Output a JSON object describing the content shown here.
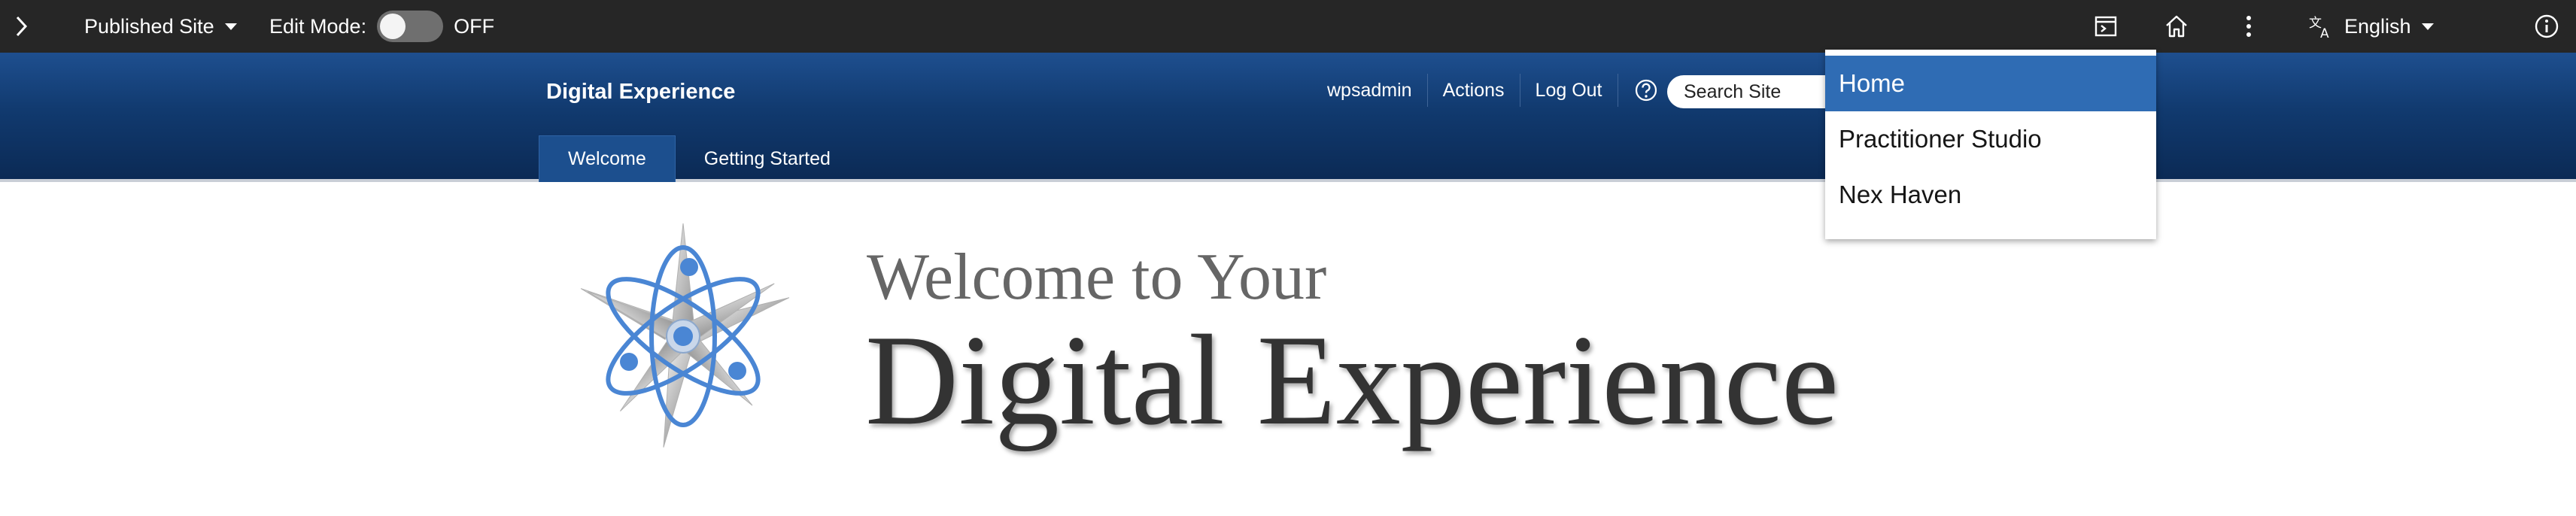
{
  "toolbar": {
    "expand_icon": "chevron-right-icon",
    "site_selector": "Published Site",
    "edit_mode_label": "Edit Mode:",
    "edit_mode_state": "OFF",
    "language": "English"
  },
  "header": {
    "brand": "Digital Experience",
    "links": [
      "wpsadmin",
      "Actions",
      "Log Out"
    ],
    "search_value": "Search Site",
    "tabs": [
      {
        "label": "Welcome",
        "active": true
      },
      {
        "label": "Getting Started",
        "active": false
      }
    ]
  },
  "dropdown": {
    "items": [
      {
        "label": "Home",
        "selected": true
      },
      {
        "label": "Practitioner Studio",
        "selected": false
      },
      {
        "label": "Nex Haven",
        "selected": false
      }
    ]
  },
  "hero": {
    "line1": "Welcome to Your",
    "line2": "Digital Experience"
  },
  "colors": {
    "toolbar_bg": "#262626",
    "header_blue": "#113a6f",
    "active_tab": "#1c4f8e",
    "menu_selected": "#2f6cb4"
  }
}
